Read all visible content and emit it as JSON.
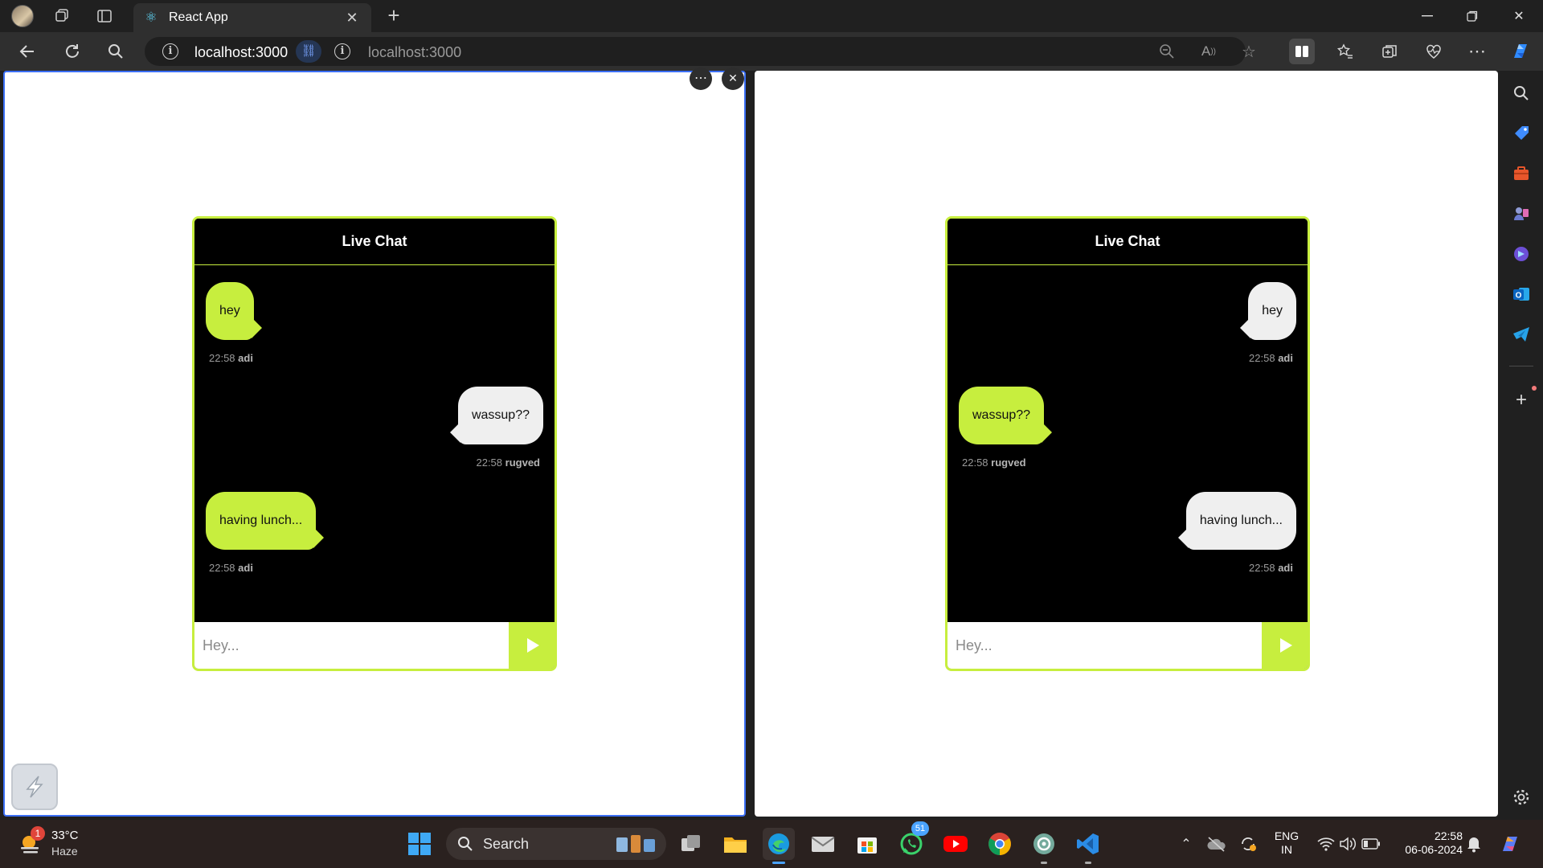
{
  "browser": {
    "tab_title": "React App",
    "url_primary": "localhost:3000",
    "url_secondary": "localhost:3000"
  },
  "split_controls": {
    "more": "⋯",
    "close": "✕"
  },
  "chats": [
    {
      "title": "Live Chat",
      "input_placeholder": "Hey...",
      "messages": [
        {
          "text": "hey",
          "time": "22:58",
          "author": "adi",
          "side": "left",
          "color": "#c7ee3e"
        },
        {
          "text": "wassup??",
          "time": "22:58",
          "author": "rugved",
          "side": "right",
          "color": "#efefef"
        },
        {
          "text": "having lunch...",
          "time": "22:58",
          "author": "adi",
          "side": "left",
          "color": "#c7ee3e"
        }
      ]
    },
    {
      "title": "Live Chat",
      "input_placeholder": "Hey...",
      "messages": [
        {
          "text": "hey",
          "time": "22:58",
          "author": "adi",
          "side": "right",
          "color": "#efefef"
        },
        {
          "text": "wassup??",
          "time": "22:58",
          "author": "rugved",
          "side": "left",
          "color": "#c7ee3e"
        },
        {
          "text": "having lunch...",
          "time": "22:58",
          "author": "adi",
          "side": "right",
          "color": "#efefef"
        }
      ]
    }
  ],
  "taskbar": {
    "weather_temp": "33°C",
    "weather_desc": "Haze",
    "weather_badge": "1",
    "search_label": "Search",
    "whatsapp_badge": "51",
    "lang_top": "ENG",
    "lang_bottom": "IN",
    "clock_time": "22:58",
    "clock_date": "06-06-2024"
  },
  "colors": {
    "accent_lime": "#c7ee3e",
    "focus_blue": "#3b6ff5"
  }
}
